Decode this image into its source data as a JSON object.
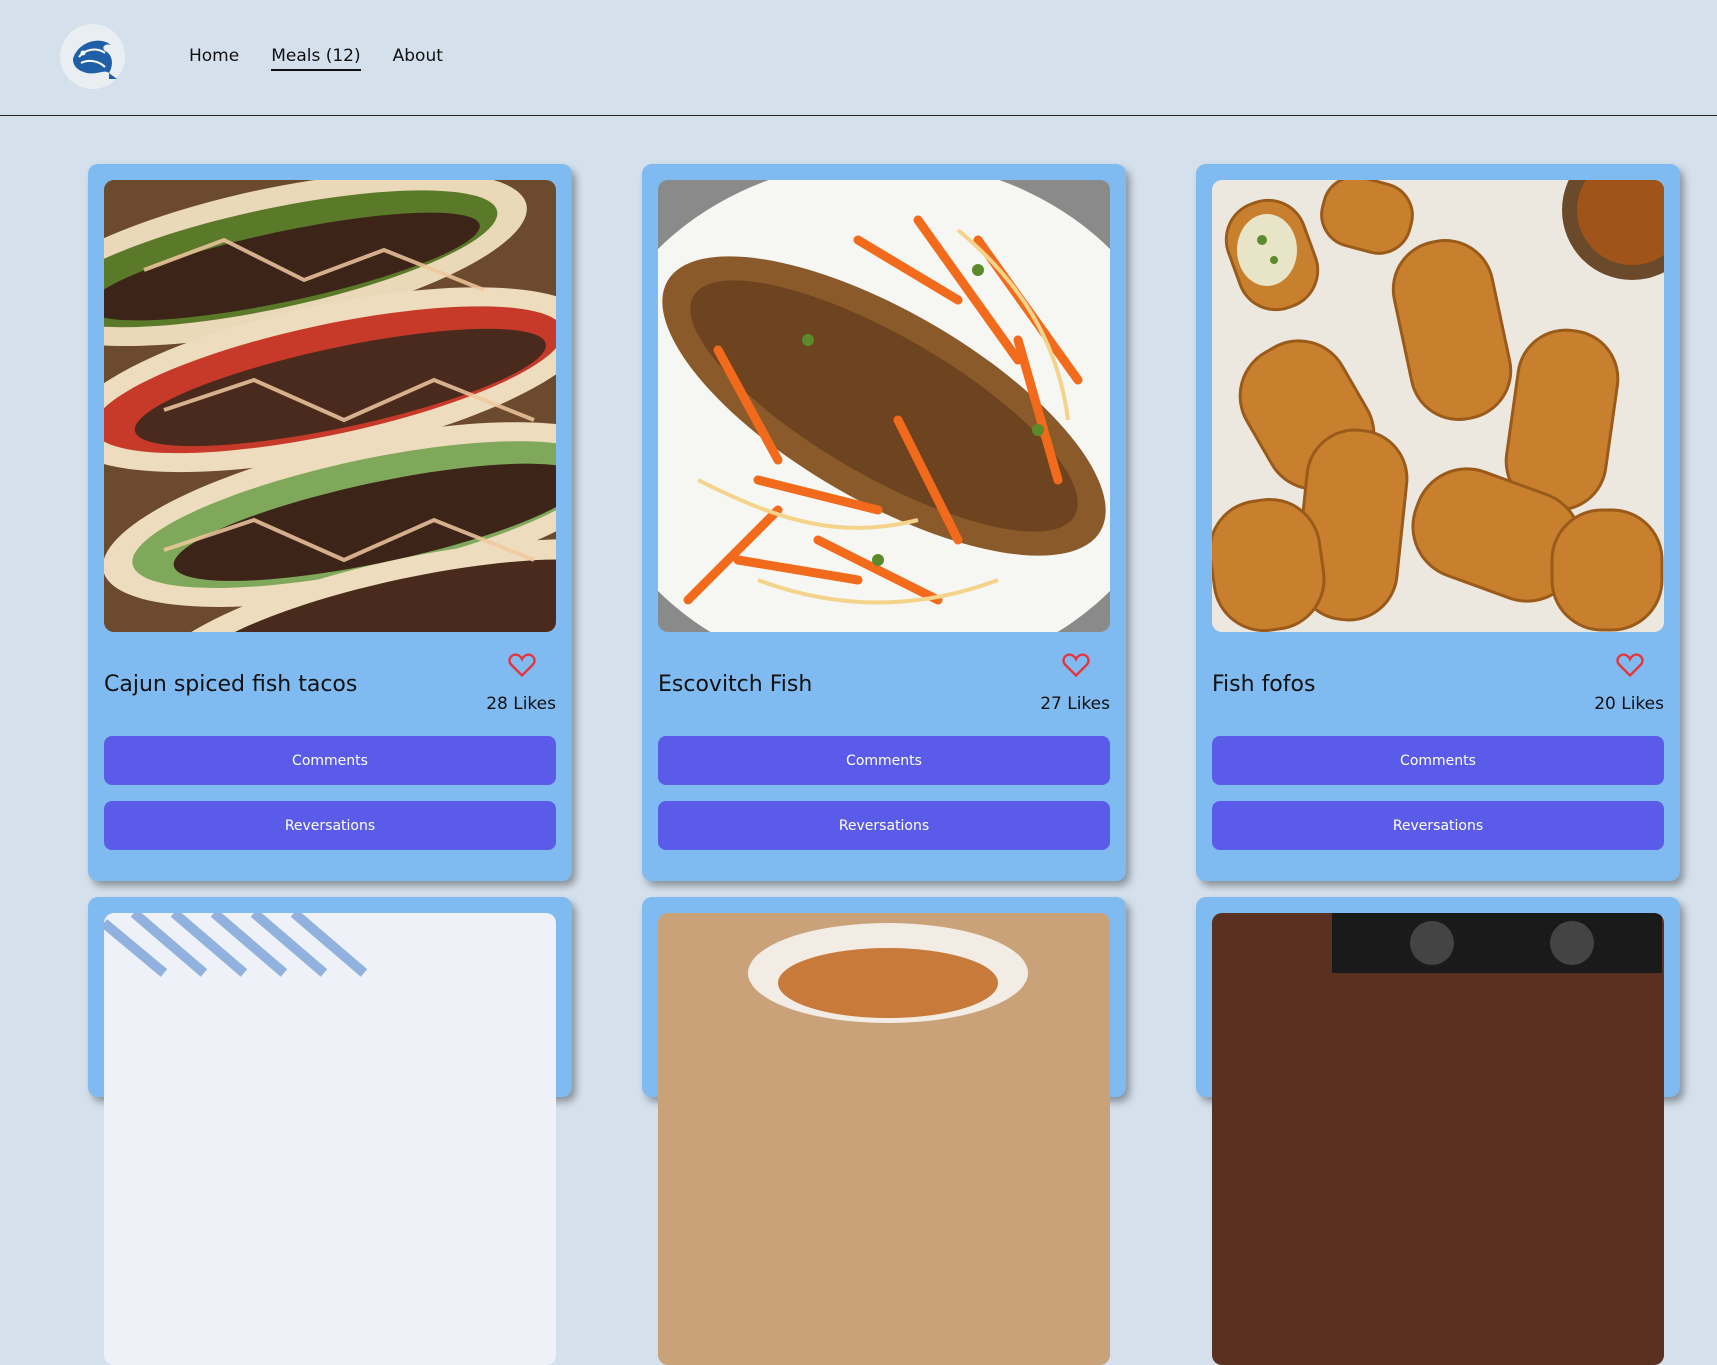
{
  "nav": {
    "logo_icon": "fish-logo-icon",
    "items": [
      {
        "label": "Home",
        "active": false
      },
      {
        "label": "Meals (12)",
        "active": true
      },
      {
        "label": "About",
        "active": false
      }
    ]
  },
  "colors": {
    "background": "#d4e1ed",
    "card": "#7fbaf0",
    "button": "#5b5bea",
    "heart": "#e8333a"
  },
  "meals": [
    {
      "title": "Cajun spiced fish tacos",
      "likes": "28 Likes",
      "comments_label": "Comments",
      "reservations_label": "Reversations",
      "icon": "heart-icon"
    },
    {
      "title": "Escovitch Fish",
      "likes": "27 Likes",
      "comments_label": "Comments",
      "reservations_label": "Reversations",
      "icon": "heart-icon"
    },
    {
      "title": "Fish fofos",
      "likes": "20 Likes",
      "comments_label": "Comments",
      "reservations_label": "Reversations",
      "icon": "heart-icon"
    }
  ]
}
